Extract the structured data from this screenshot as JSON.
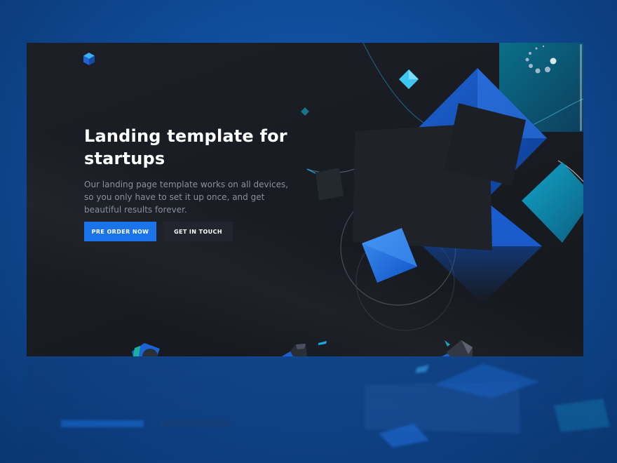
{
  "hero": {
    "title_line1": "Landing template for",
    "title_line2": "startups",
    "description": "Our landing page template works on all devices, so you only have to set it up once, and get beautiful results forever."
  },
  "buttons": {
    "primary_label": "PRE ORDER NOW",
    "secondary_label": "GET IN TOUCH"
  },
  "colors": {
    "background_blue": "#0f4c99",
    "page_dark": "#1c1f26",
    "accent_blue": "#1a73e8",
    "cyan": "#22b8e6"
  },
  "icons": {
    "logo": "cube-logo-icon"
  }
}
